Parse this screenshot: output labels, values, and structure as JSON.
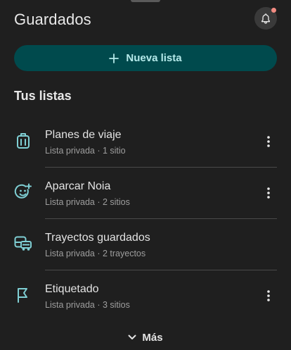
{
  "header": {
    "title": "Guardados"
  },
  "new_list_button": {
    "label": "Nueva lista"
  },
  "section": {
    "title": "Tus listas"
  },
  "lists": [
    {
      "title": "Planes de viaje",
      "subtitle": "Lista privada · 1 sitio",
      "icon": "suitcase-icon"
    },
    {
      "title": "Aparcar Noia",
      "subtitle": "Lista privada · 2 sitios",
      "icon": "emoji-add-icon"
    },
    {
      "title": "Trayectos guardados",
      "subtitle": "Lista privada · 2 trayectos",
      "icon": "transit-icon"
    },
    {
      "title": "Etiquetado",
      "subtitle": "Lista privada · 3 sitios",
      "icon": "flag-icon"
    }
  ],
  "show_more": {
    "label": "Más"
  },
  "colors": {
    "background": "#1f1f1f",
    "accent_button": "#004a4d",
    "accent_text": "#b5eaea",
    "icon_teal": "#7fcfd4",
    "notification_dot": "#f28b82"
  }
}
